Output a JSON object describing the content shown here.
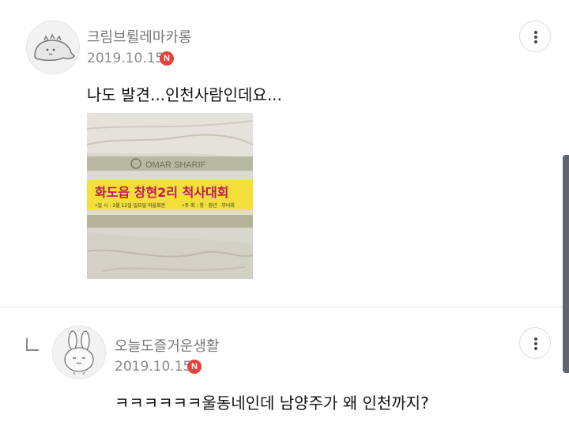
{
  "comments": [
    {
      "author": "크림브륄레마카롱",
      "date": "2019.10.15",
      "badge": "N",
      "text": "나도 발견...인천사람인데요..."
    },
    {
      "author": "오늘도즐거운생활",
      "date": "2019.10.15",
      "badge": "N",
      "text": "ㅋㅋㅋㅋㅋㅋ울동네인데 남양주가 왜 인천까지?"
    }
  ],
  "photo": {
    "brand": "OMAR SHARIF",
    "banner_text": "화도읍 창현2리 척사대회",
    "sub_left": "•일 시 : 2월 12일 일요일 마을회관",
    "sub_right": "•주 최 : 청 · 장년 · 부녀회"
  },
  "colors": {
    "badge": "#e8403c",
    "banner": "#f2df3a",
    "banner_text": "#c2185b"
  },
  "icons": [
    "dinosaur-avatar-icon",
    "bunny-avatar-icon",
    "more-vertical-icon",
    "reply-arrow-icon"
  ]
}
